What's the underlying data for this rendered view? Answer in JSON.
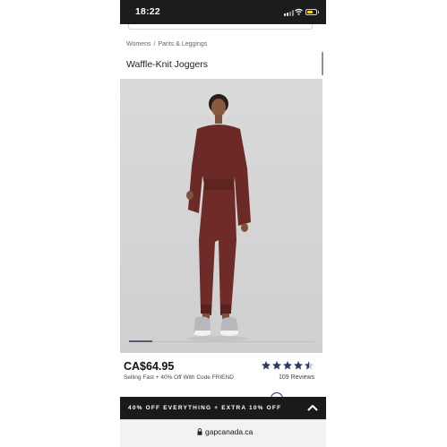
{
  "status_bar": {
    "time": "18:22"
  },
  "breadcrumb": {
    "level1": "Womens",
    "separator": "/",
    "level2": "Pants & Leggings"
  },
  "product": {
    "title": "Waffle-Knit Joggers",
    "price": "CA$64.95",
    "promo": "Selling Fast + 40% Off With Code FRIEND",
    "rating": 4.5,
    "reviews": "109 Reviews"
  },
  "carousel": {
    "current_slide": 1
  },
  "banner": {
    "text": "40% OFF EVERYTHING + EXTRA 10% OFF"
  },
  "browser": {
    "url": "gapcanada.ca"
  },
  "colors": {
    "garment": "#6b2a26",
    "photo_background": "#d8d8d8",
    "star": "#2b3a67",
    "banner": "#1a1a1a"
  },
  "icons": [
    "signal-icon",
    "wifi-icon",
    "battery-icon",
    "star-icon",
    "chevron-up-icon",
    "lock-icon"
  ]
}
